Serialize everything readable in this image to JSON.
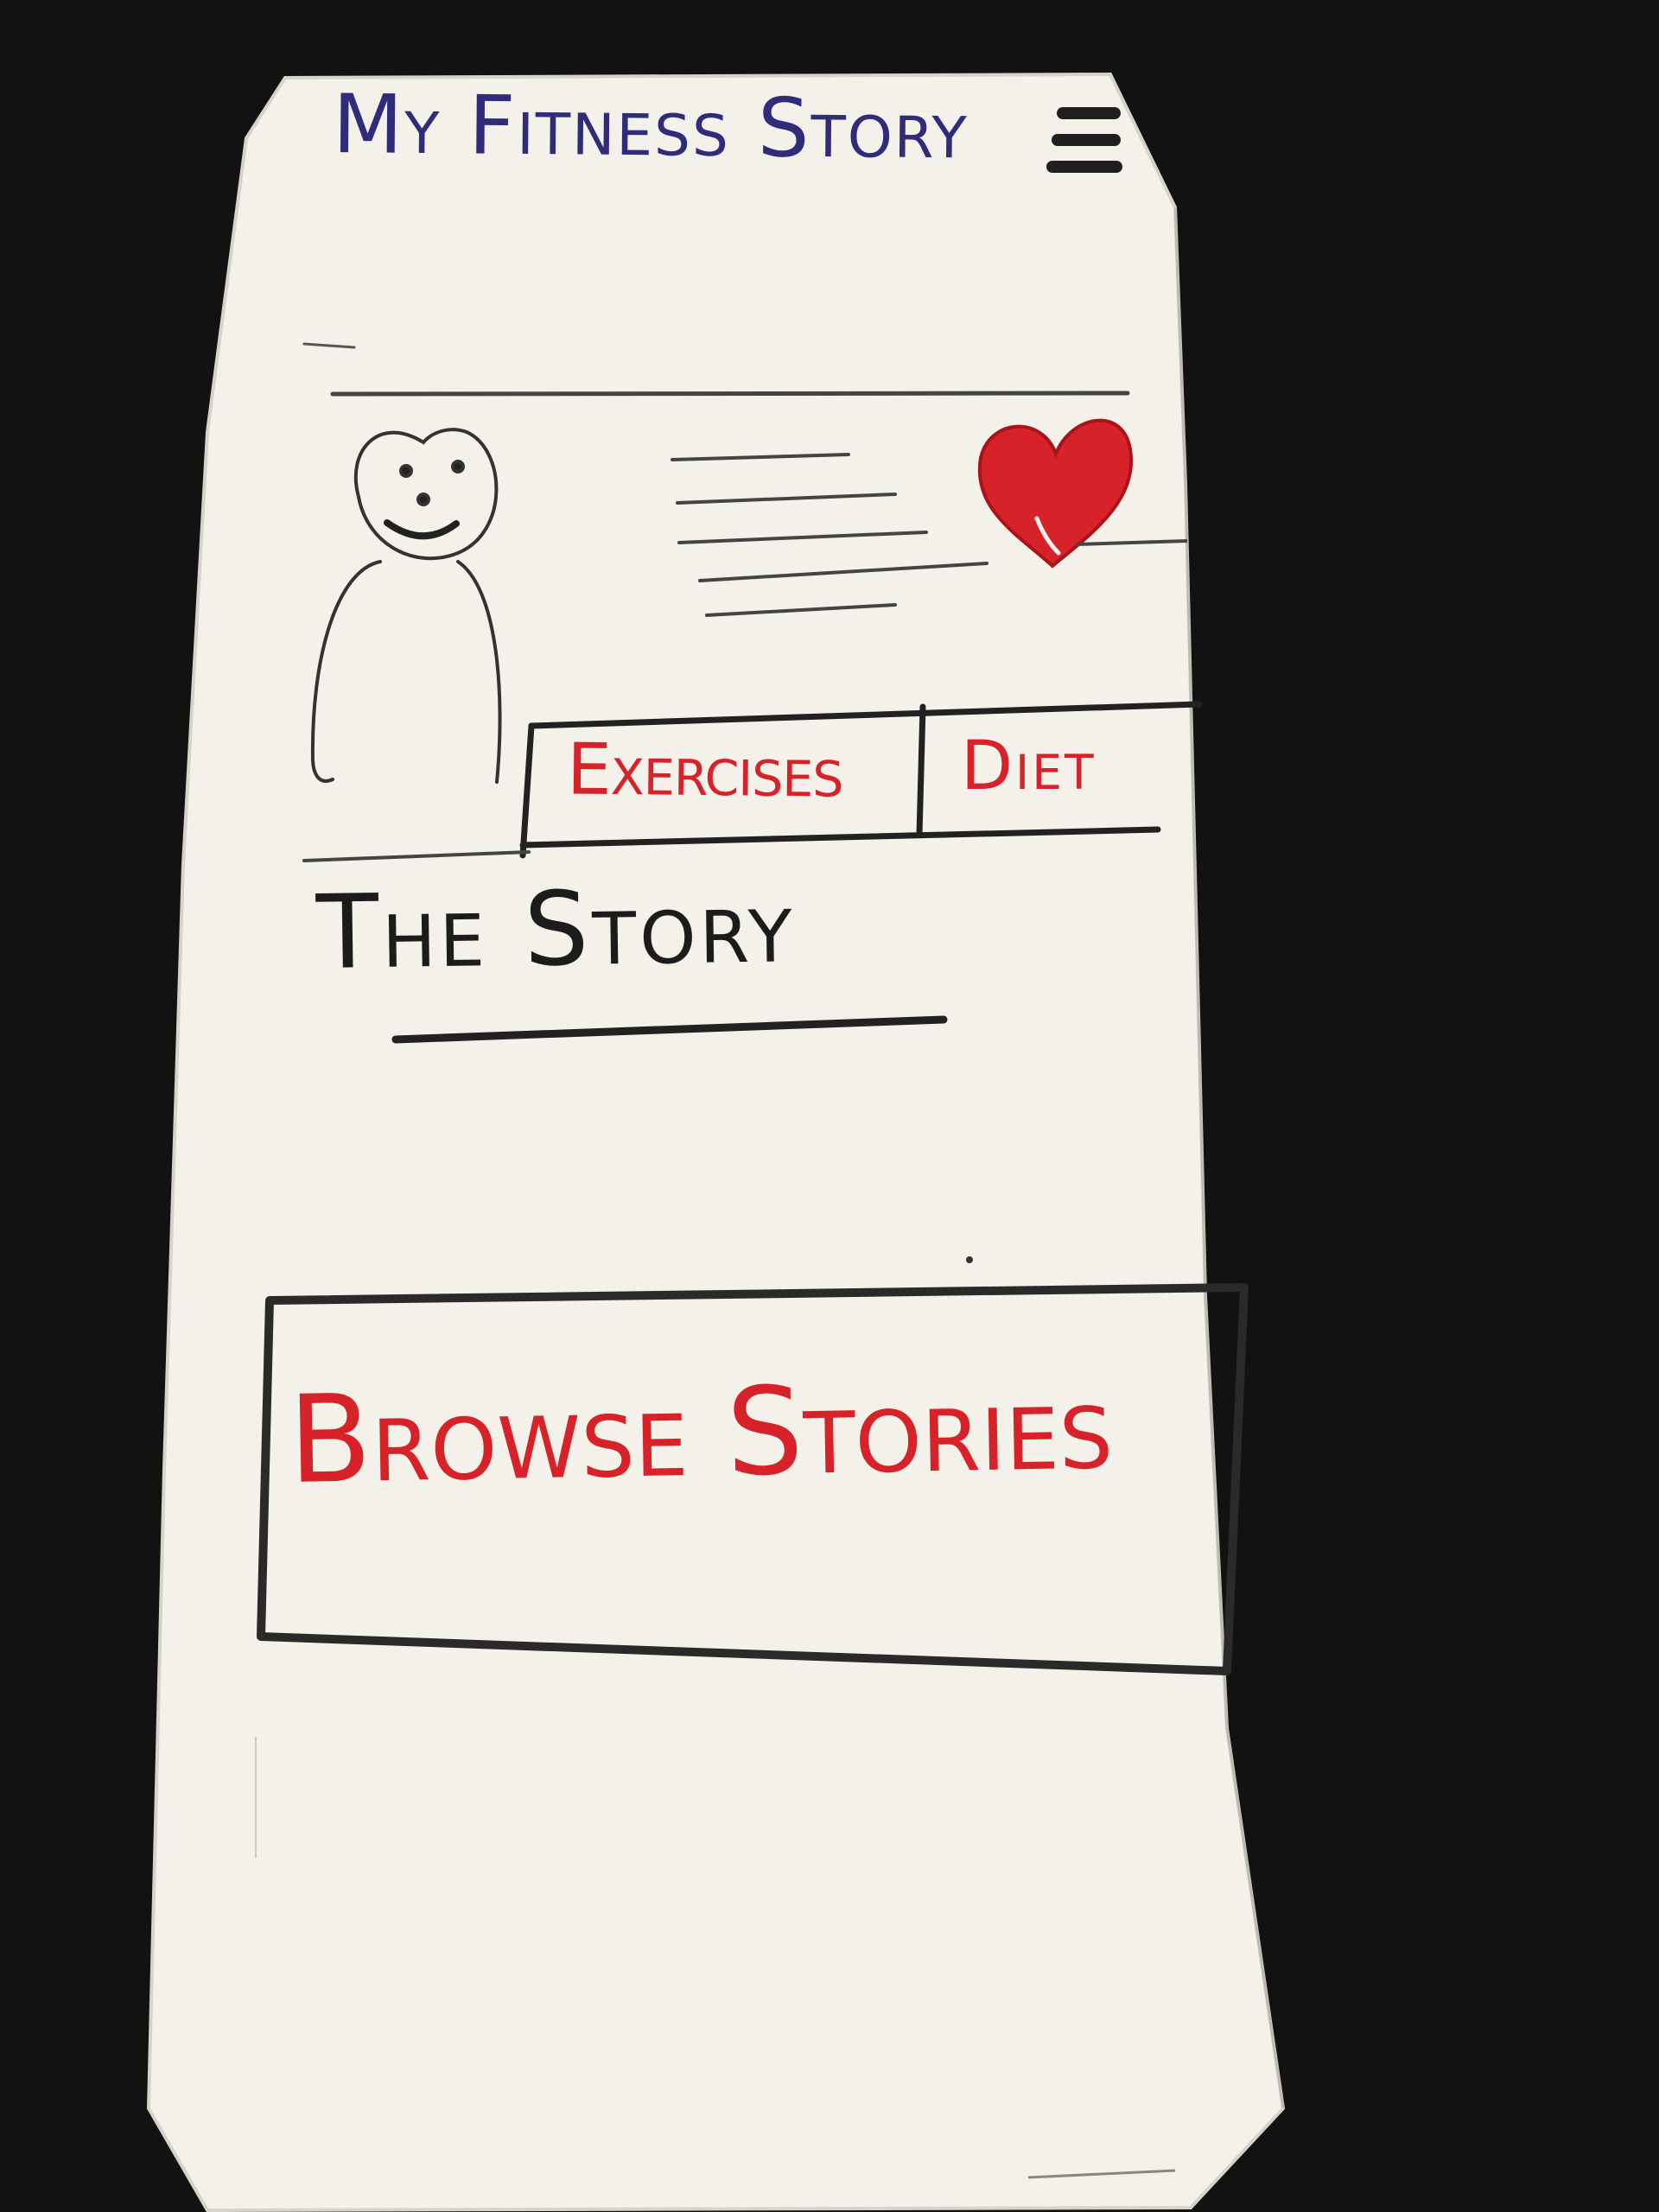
{
  "app": {
    "title": "My Fitness Story",
    "menu_icon": "hamburger-menu-icon"
  },
  "profile": {
    "avatar_icon": "stick-figure-avatar-icon",
    "favorite_icon": "heart-icon",
    "favorite_color": "#d8222a"
  },
  "tabs": [
    {
      "label": "Exercises"
    },
    {
      "label": "Diet"
    }
  ],
  "story": {
    "heading": "The Story"
  },
  "browse": {
    "label": "Browse Stories"
  },
  "colors": {
    "background": "#121212",
    "paper": "#f3f1e9",
    "ink_black": "#1f1f1f",
    "ink_blue": "#2f2d7a",
    "ink_red": "#d8222a"
  }
}
